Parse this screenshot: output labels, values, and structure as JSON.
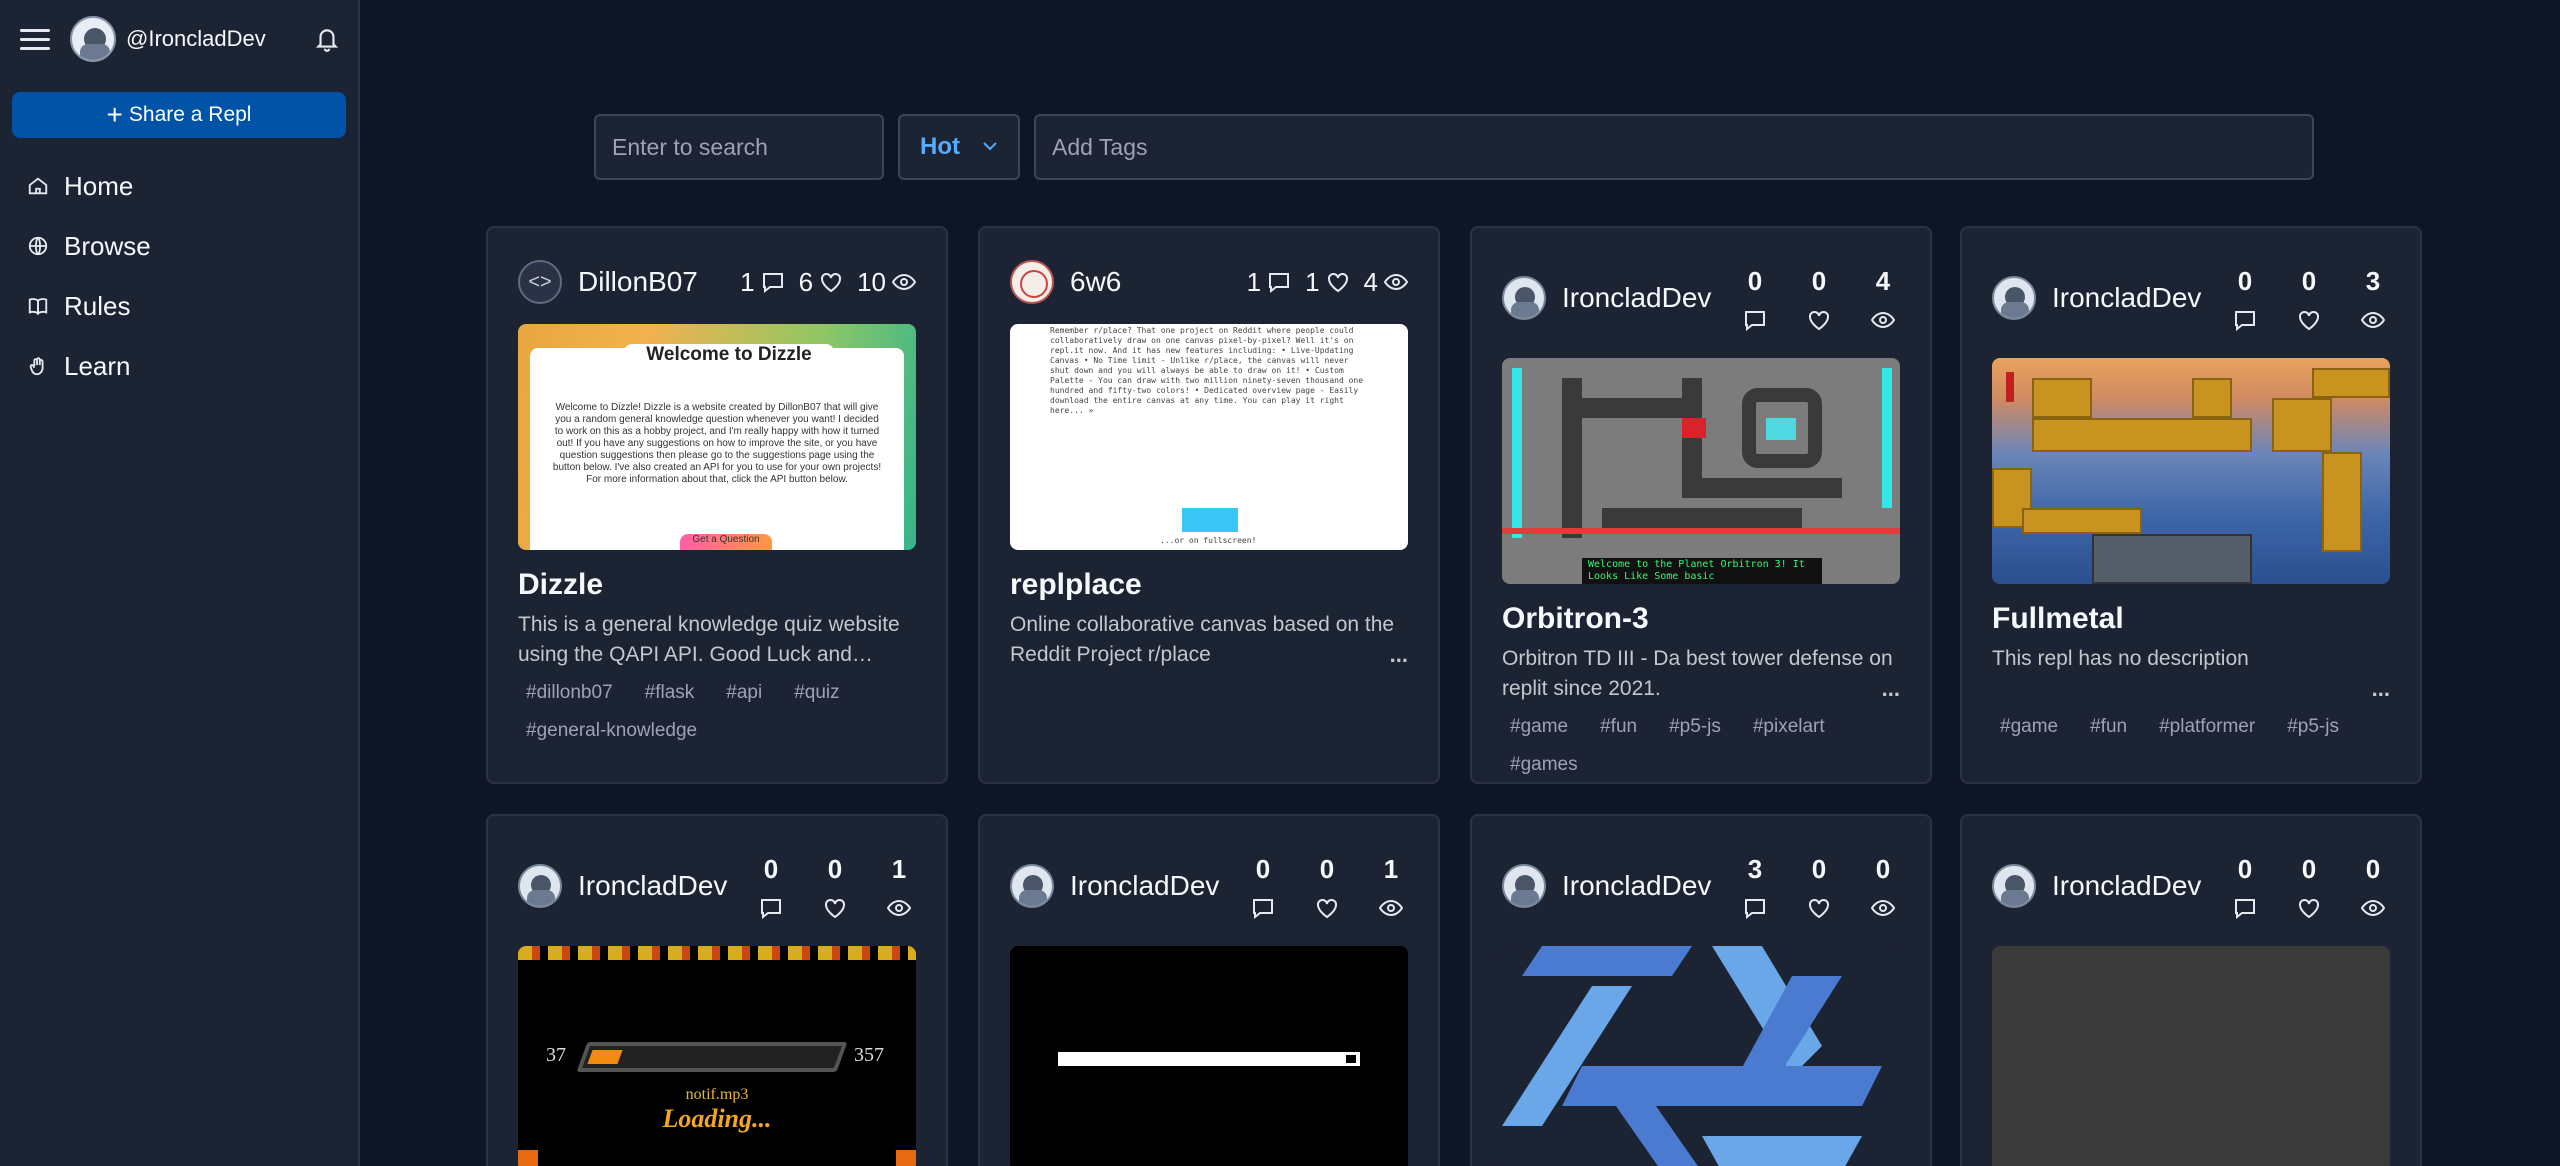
{
  "sidebar": {
    "username": "@IroncladDev",
    "share_button": "Share a Repl",
    "nav": [
      {
        "label": "Home",
        "icon": "home-icon"
      },
      {
        "label": "Browse",
        "icon": "globe-icon"
      },
      {
        "label": "Rules",
        "icon": "book-icon"
      },
      {
        "label": "Learn",
        "icon": "hand-icon"
      }
    ]
  },
  "search": {
    "placeholder": "Enter to search",
    "sort_value": "Hot",
    "tags_placeholder": "Add Tags"
  },
  "cards": [
    {
      "user": "DillonB07",
      "comments": "1",
      "likes": "6",
      "views": "10",
      "title": "Dizzle",
      "description": "This is a general knowledge quiz website using the QAPI API. Good Luck and have...",
      "tags": [
        "#dillonb07",
        "#flask",
        "#api",
        "#quiz",
        "#general-knowledge"
      ],
      "thumb_heading": "Welcome to Dizzle",
      "thumb_text": "Welcome to Dizzle! Dizzle is a website created by DillonB07 that will give you a random general knowledge question whenever you want! I decided to work on this as a hobby project, and I'm really happy with how it turned out! If you have any suggestions on how to improve the site, or you have question suggestions then please go to the suggestions page using the button below. I've also created an API for you to use for your own projects! For more information about that, click the API button below.",
      "thumb_button": "Get a Question"
    },
    {
      "user": "6w6",
      "comments": "1",
      "likes": "1",
      "views": "4",
      "title": "replplace",
      "description": "Online collaborative canvas based on the Reddit Project r/place",
      "ellipsis": "...",
      "thumb_text": "Remember r/place? That one project on Reddit where people could collaboratively draw on one canvas pixel-by-pixel? Well it's on repl.it now. And it has new features including: • Live-Updating Canvas • No Time limit - Unlike r/place, the canvas will never shut down and you will always be able to draw on it! • Custom Palette - You can draw with two million ninety-seven thousand one hundred and fifty-two colors! • Dedicated overview page - Easily download the entire canvas at any time. You can play it right here... »",
      "thumb_footer": "...or on fullscreen!"
    },
    {
      "user": "IroncladDev",
      "comments": "0",
      "likes": "0",
      "views": "4",
      "title": "Orbitron-3",
      "description": "Orbitron TD III - Da best tower defense on replit since 2021.",
      "ellipsis": "...",
      "tags": [
        "#game",
        "#fun",
        "#p5-js",
        "#pixelart",
        "#games"
      ],
      "thumb_banner": "Welcome to the Planet Orbitron 3! It Looks Like Some basic"
    },
    {
      "user": "IroncladDev",
      "comments": "0",
      "likes": "0",
      "views": "3",
      "title": "Fullmetal",
      "description": "This repl has no description",
      "ellipsis": "...",
      "tags": [
        "#game",
        "#fun",
        "#platformer",
        "#p5-js"
      ]
    },
    {
      "user": "IroncladDev",
      "comments": "0",
      "likes": "0",
      "views": "1",
      "thumb_left": "37",
      "thumb_right": "357",
      "thumb_file": "notif.mp3",
      "thumb_loading": "Loading..."
    },
    {
      "user": "IroncladDev",
      "comments": "0",
      "likes": "0",
      "views": "1"
    },
    {
      "user": "IroncladDev",
      "comments": "3",
      "likes": "0",
      "views": "0"
    },
    {
      "user": "IroncladDev",
      "comments": "0",
      "likes": "0",
      "views": "0"
    }
  ],
  "colors": {
    "background": "#0e1525",
    "surface": "#1c2333",
    "border": "#2b3245",
    "accent": "#0053a6",
    "sort_text": "#57abff"
  }
}
